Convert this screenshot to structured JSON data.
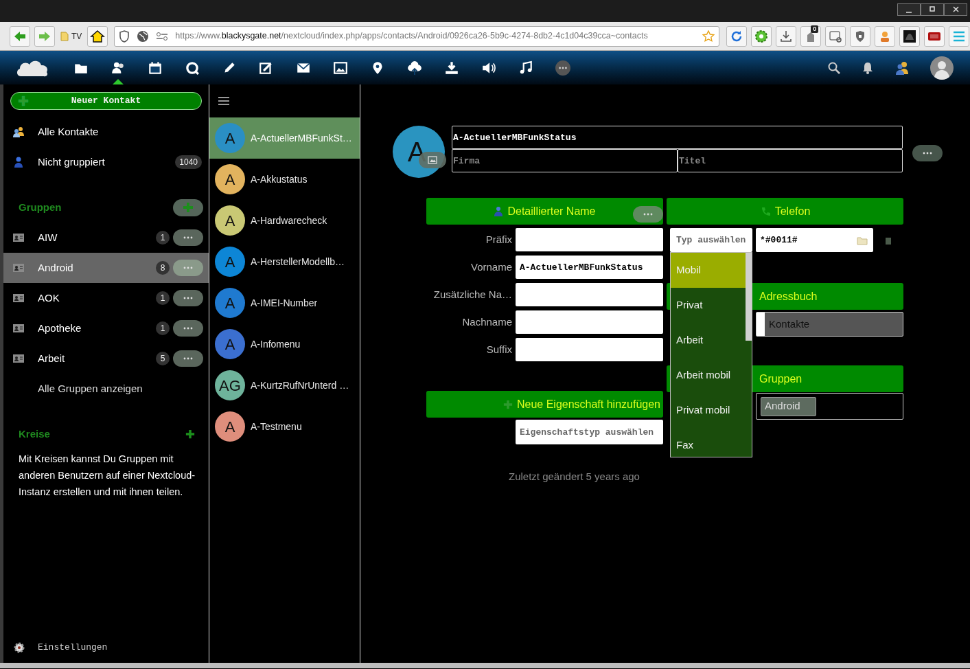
{
  "browser": {
    "bookmark": "TV",
    "url": "https://www.**blackysgate.net**/nextcloud/index.php/apps/contacts/Android/0926ca26-5b9c-4274-8db2-4c1d04c39cca~contacts",
    "badge": "0"
  },
  "app_icons": [
    {
      "kind": "files",
      "selected": false
    },
    {
      "kind": "contacts",
      "selected": true
    },
    {
      "kind": "calendar",
      "selected": false
    },
    {
      "kind": "talk",
      "selected": false
    },
    {
      "kind": "notes",
      "selected": false
    },
    {
      "kind": "tasks",
      "selected": false
    },
    {
      "kind": "mail",
      "selected": false
    },
    {
      "kind": "photos",
      "selected": false
    },
    {
      "kind": "maps",
      "selected": false
    },
    {
      "kind": "upload",
      "selected": false
    },
    {
      "kind": "download",
      "selected": false
    },
    {
      "kind": "audio",
      "selected": false
    },
    {
      "kind": "music",
      "selected": false
    },
    {
      "kind": "more",
      "selected": false
    }
  ],
  "sidebar": {
    "new_contact": "Neuer Kontakt",
    "items": [
      {
        "label": "Alle Kontakte",
        "kind": "all"
      },
      {
        "label": "Nicht gruppiert",
        "kind": "ungrouped",
        "count": "1040"
      }
    ],
    "groups_heading": "Gruppen",
    "groups": [
      {
        "name": "AIW",
        "count": "1",
        "selected": false
      },
      {
        "name": "Android",
        "count": "8",
        "selected": true
      },
      {
        "name": "AOK",
        "count": "1",
        "selected": false
      },
      {
        "name": "Apotheke",
        "count": "1",
        "selected": false
      },
      {
        "name": "Arbeit",
        "count": "5",
        "selected": false
      }
    ],
    "show_all_groups": "Alle Gruppen anzeigen",
    "circles_heading": "Kreise",
    "circles_text": "Mit Kreisen kannst Du Gruppen mit anderen Benutzern auf einer Nextcloud-Instanz erstellen und mit ihnen teilen.",
    "settings": "Einstellungen"
  },
  "contacts": [
    {
      "initials": "A",
      "name": "A-ActuellerMBFunkSt…",
      "color": "#2a8fc4",
      "selected": true
    },
    {
      "initials": "A",
      "name": "A-Akkustatus",
      "color": "#e2b35e",
      "selected": false
    },
    {
      "initials": "A",
      "name": "A-Hardwarecheck",
      "color": "#c9c874",
      "selected": false
    },
    {
      "initials": "A",
      "name": "A-HerstellerModellb…",
      "color": "#0d86d6",
      "selected": false
    },
    {
      "initials": "A",
      "name": "A-IMEI-Number",
      "color": "#1f7ad0",
      "selected": false
    },
    {
      "initials": "A",
      "name": "A-Infomenu",
      "color": "#3b6fd0",
      "selected": false
    },
    {
      "initials": "AG",
      "name": "A-KurtzRufNrUnterd …",
      "color": "#6eb39b",
      "selected": false
    },
    {
      "initials": "A",
      "name": "A-Testmenu",
      "color": "#df8e7c",
      "selected": false
    }
  ],
  "details": {
    "avatar_initial": "A",
    "name": "A-ActuellerMBFunkStatus",
    "company_placeholder": "Firma",
    "title_placeholder": "Titel",
    "name_section": {
      "title": "Detaillierter Name",
      "fields": [
        {
          "label": "Präfix"
        },
        {
          "label": "Vorname",
          "value": "A-ActuellerMBFunkStatus"
        },
        {
          "label": "Zusätzliche Na…"
        },
        {
          "label": "Nachname"
        },
        {
          "label": "Suffix"
        }
      ]
    },
    "add_property": {
      "title": "Neue Eigenschaft hinzufügen",
      "placeholder": "Eigenschaftstyp auswählen"
    },
    "last_modified": "Zuletzt geändert 5 years ago",
    "phone_section": {
      "title": "Telefon",
      "type_placeholder": "Typ auswählen",
      "value": "*#0011#",
      "type_options": [
        {
          "label": "Mobil",
          "selected": true
        },
        {
          "label": "Privat",
          "selected": false
        },
        {
          "label": "Arbeit",
          "selected": false
        },
        {
          "label": "Arbeit mobil",
          "selected": false
        },
        {
          "label": "Privat mobil",
          "selected": false
        },
        {
          "label": "Fax",
          "selected": false
        }
      ]
    },
    "addressbook_section": {
      "title": "Adressbuch",
      "value": "Kontakte"
    },
    "groups_section": {
      "title": "Gruppen",
      "tags": [
        "Android"
      ]
    }
  }
}
